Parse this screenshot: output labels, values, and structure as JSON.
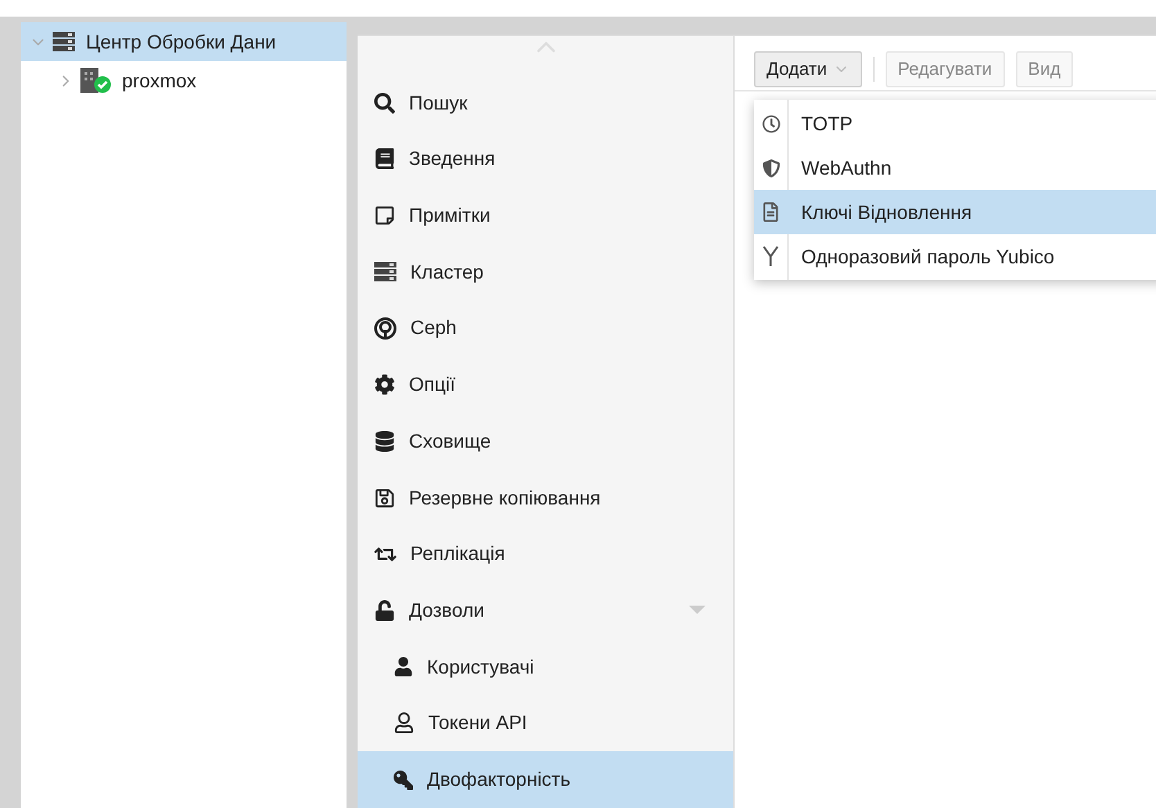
{
  "tree": [
    {
      "label": "Центр Обробки Дани",
      "expanded": true,
      "selected": true,
      "children": [
        {
          "label": "proxmox",
          "expanded": false,
          "selected": false
        }
      ]
    }
  ],
  "nav": [
    {
      "label": "Пошук",
      "selected": false
    },
    {
      "label": "Зведення",
      "selected": false
    },
    {
      "label": "Примітки",
      "selected": false
    },
    {
      "label": "Кластер",
      "selected": false
    },
    {
      "label": "Ceph",
      "selected": false
    },
    {
      "label": "Опції",
      "selected": false
    },
    {
      "label": "Сховище",
      "selected": false
    },
    {
      "label": "Резервне копіювання",
      "selected": false
    },
    {
      "label": "Реплікація",
      "selected": false
    },
    {
      "label": "Дозволи",
      "selected": false,
      "expanded": true,
      "children": [
        {
          "label": "Користувачі",
          "selected": false
        },
        {
          "label": "Токени API",
          "selected": false
        },
        {
          "label": "Двофакторність",
          "selected": true
        }
      ]
    }
  ],
  "toolbar": [
    {
      "label": "Додати",
      "disabled": false,
      "menu": true
    },
    {
      "label": "Редагувати",
      "disabled": true,
      "menu": false
    },
    {
      "label": "Вид",
      "disabled": true,
      "menu": false
    }
  ],
  "add_menu": [
    {
      "label": "TOTP",
      "selected": false
    },
    {
      "label": "WebAuthn",
      "selected": false
    },
    {
      "label": "Ключі Відновлення",
      "selected": true
    },
    {
      "label": "Одноразовий пароль Yubico",
      "selected": false
    }
  ]
}
